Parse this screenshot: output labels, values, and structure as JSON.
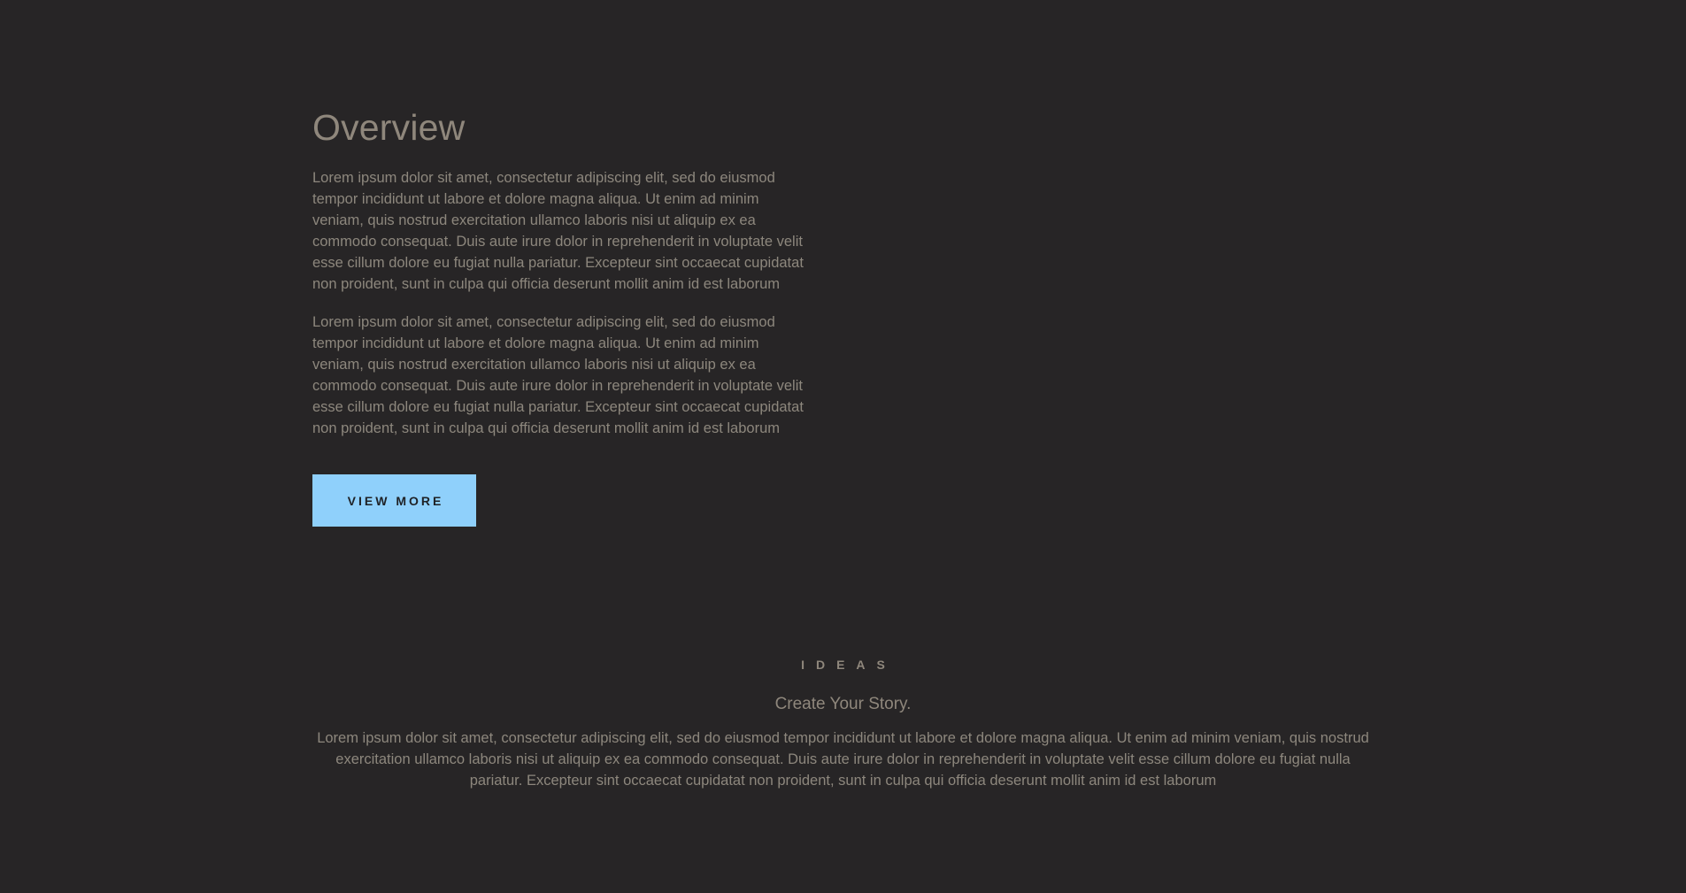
{
  "overview": {
    "title": "Overview",
    "paragraph_1": "Lorem ipsum dolor sit amet, consectetur adipiscing elit, sed do eiusmod tempor incididunt ut labore et dolore magna aliqua. Ut enim ad minim veniam, quis nostrud exercitation ullamco laboris nisi ut aliquip ex ea commodo consequat. Duis aute irure dolor in reprehenderit in voluptate velit esse cillum dolore eu fugiat nulla pariatur. Excepteur sint occaecat cupidatat non proident, sunt in culpa qui officia deserunt mollit anim id est laborum",
    "paragraph_2": "Lorem ipsum dolor sit amet, consectetur adipiscing elit, sed do eiusmod tempor incididunt ut labore et dolore magna aliqua. Ut enim ad minim veniam, quis nostrud exercitation ullamco laboris nisi ut aliquip ex ea commodo consequat. Duis aute irure dolor in reprehenderit in voluptate velit esse cillum dolore eu fugiat nulla pariatur. Excepteur sint occaecat cupidatat non proident, sunt in culpa qui officia deserunt mollit anim id est laborum",
    "button_label": "VIEW MORE"
  },
  "ideas": {
    "eyebrow": "IDEAS",
    "heading": "Create Your Story.",
    "body": "Lorem ipsum dolor sit amet, consectetur adipiscing elit, sed do eiusmod tempor incididunt ut labore et dolore magna aliqua. Ut enim ad minim veniam, quis nostrud exercitation ullamco laboris nisi ut aliquip ex ea commodo consequat. Duis aute irure dolor in reprehenderit in voluptate velit esse cillum dolore eu fugiat nulla pariatur. Excepteur sint occaecat cupidatat non proident, sunt in culpa qui officia deserunt mollit anim id est laborum"
  },
  "colors": {
    "background": "#272526",
    "text": "#8d877d",
    "accent_button": "#8fd0fb",
    "button_text": "#1f2226"
  }
}
